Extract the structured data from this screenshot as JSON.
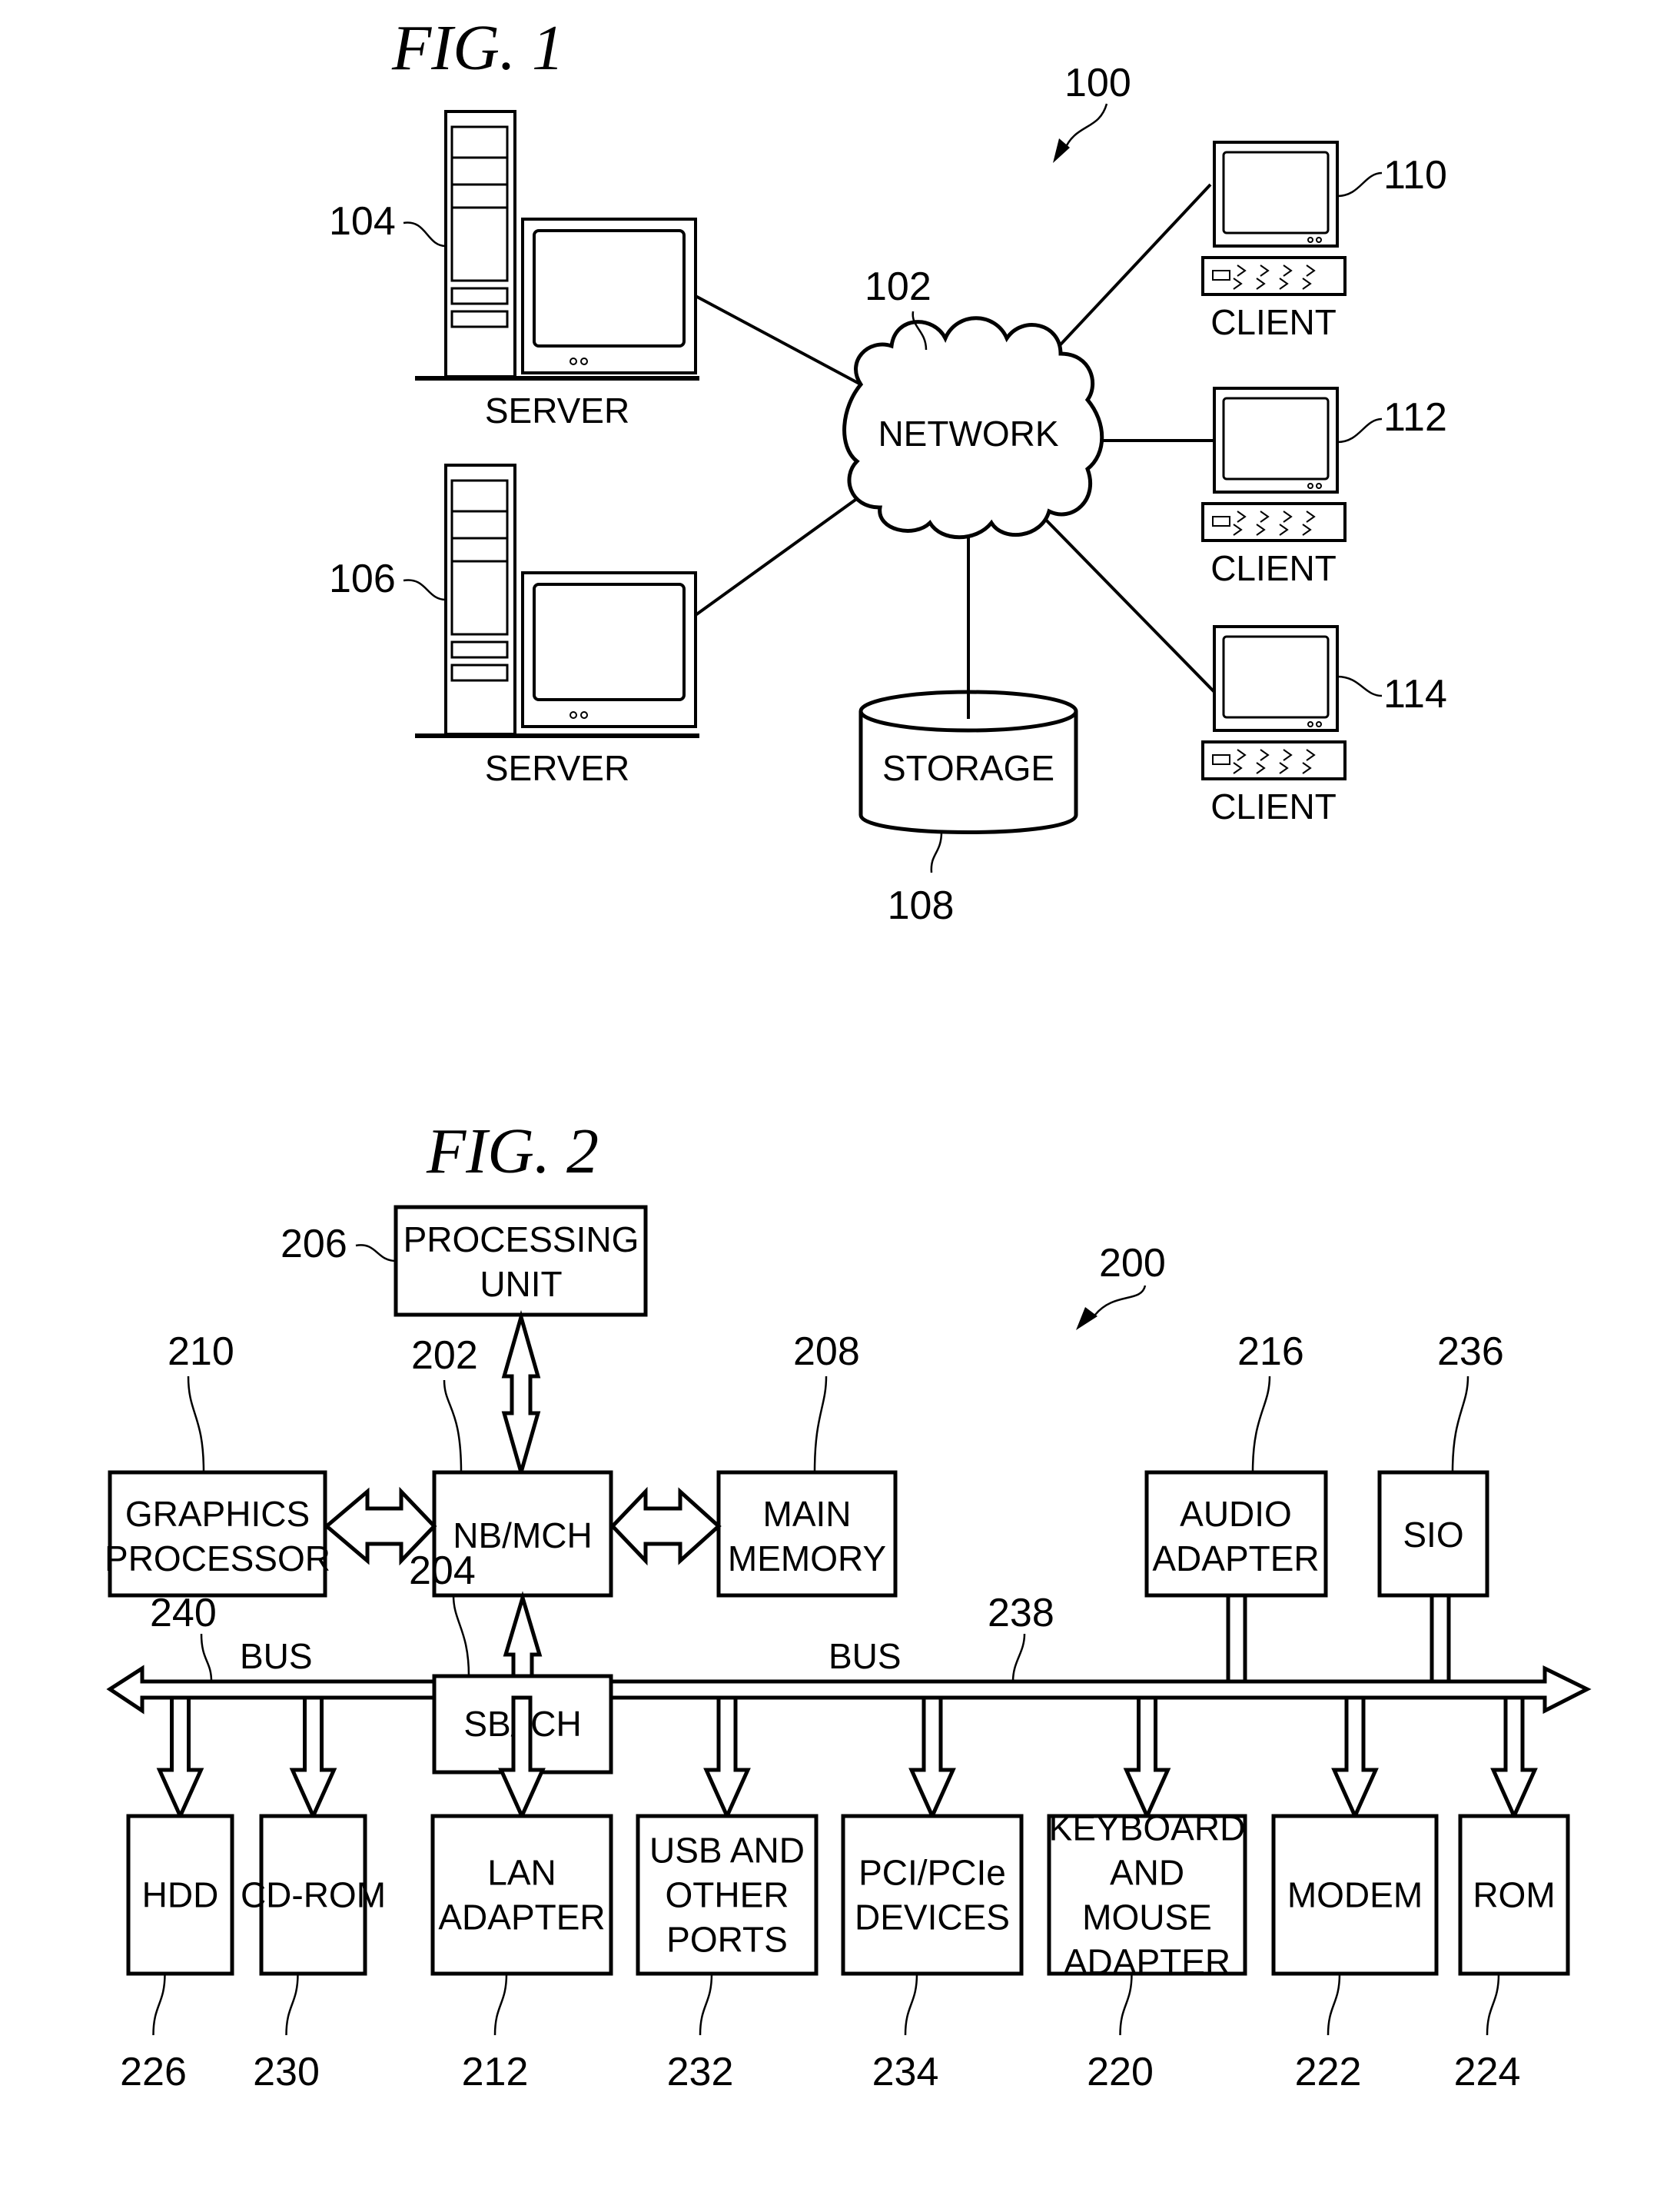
{
  "fig1": {
    "title": "FIG. 1",
    "system_ref": "100",
    "network": {
      "ref": "102",
      "label": "NETWORK"
    },
    "servers": [
      {
        "ref": "104",
        "label": "SERVER"
      },
      {
        "ref": "106",
        "label": "SERVER"
      }
    ],
    "storage": {
      "ref": "108",
      "label": "STORAGE"
    },
    "clients": [
      {
        "ref": "110",
        "label": "CLIENT"
      },
      {
        "ref": "112",
        "label": "CLIENT"
      },
      {
        "ref": "114",
        "label": "CLIENT"
      }
    ]
  },
  "fig2": {
    "title": "FIG. 2",
    "system_ref": "200",
    "processing_unit": {
      "ref": "206",
      "lines": [
        "PROCESSING",
        "UNIT"
      ]
    },
    "nb_mch": {
      "ref": "202",
      "lines": [
        "NB/MCH"
      ]
    },
    "graphics": {
      "ref": "210",
      "lines": [
        "GRAPHICS",
        "PROCESSOR"
      ]
    },
    "main_memory": {
      "ref": "208",
      "lines": [
        "MAIN",
        "MEMORY"
      ]
    },
    "sb_ich": {
      "ref": "204",
      "lines": [
        "SB/ICH"
      ]
    },
    "audio": {
      "ref": "216",
      "lines": [
        "AUDIO",
        "ADAPTER"
      ]
    },
    "sio": {
      "ref": "236",
      "lines": [
        "SIO"
      ]
    },
    "bus_left": {
      "ref": "240",
      "label": "BUS"
    },
    "bus_right": {
      "ref": "238",
      "label": "BUS"
    },
    "devices": [
      {
        "ref": "226",
        "lines": [
          "HDD"
        ]
      },
      {
        "ref": "230",
        "lines": [
          "CD-ROM"
        ]
      },
      {
        "ref": "212",
        "lines": [
          "LAN",
          "ADAPTER"
        ]
      },
      {
        "ref": "232",
        "lines": [
          "USB AND",
          "OTHER",
          "PORTS"
        ]
      },
      {
        "ref": "234",
        "lines": [
          "PCI/PCIe",
          "DEVICES"
        ]
      },
      {
        "ref": "220",
        "lines": [
          "KEYBOARD",
          "AND",
          "MOUSE",
          "ADAPTER"
        ]
      },
      {
        "ref": "222",
        "lines": [
          "MODEM"
        ]
      },
      {
        "ref": "224",
        "lines": [
          "ROM"
        ]
      }
    ]
  }
}
